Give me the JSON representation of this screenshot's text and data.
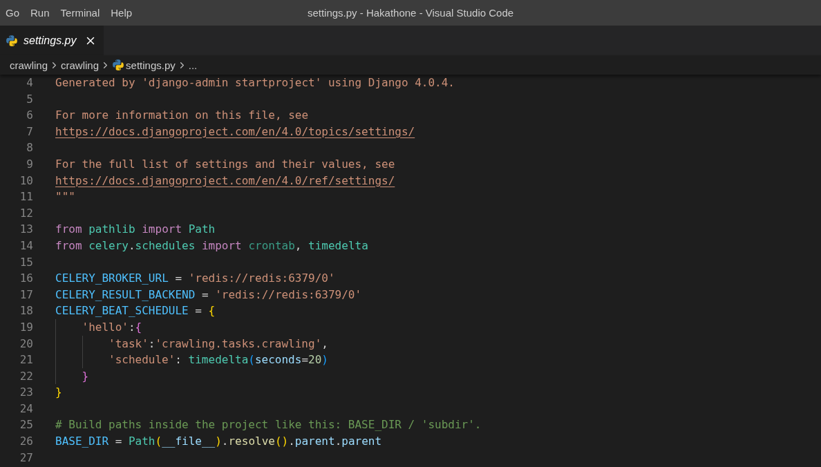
{
  "menu_bar": {
    "items": [
      "Go",
      "Run",
      "Terminal",
      "Help"
    ],
    "title": "settings.py - Hakathone - Visual Studio Code"
  },
  "tabs": [
    {
      "label": "settings.py",
      "selected": true,
      "preview": true
    }
  ],
  "breadcrumbs": [
    {
      "label": "crawling",
      "kind": "folder"
    },
    {
      "label": "crawling",
      "kind": "folder"
    },
    {
      "label": "settings.py",
      "kind": "file"
    },
    {
      "label": "...",
      "kind": "symbol"
    }
  ],
  "editor": {
    "lines": [
      {
        "number": "4",
        "tokens": [
          {
            "kind": "doc",
            "text": "Generated by 'django-admin startproject' using Django 4.0.4."
          }
        ]
      },
      {
        "number": "5"
      },
      {
        "number": "6",
        "tokens": [
          {
            "kind": "doc",
            "text": "For more information on this file, see"
          }
        ]
      },
      {
        "number": "7",
        "tokens": [
          {
            "kind": "link",
            "text": "https://docs.djangoproject.com/en/4.0/topics/settings/"
          }
        ]
      },
      {
        "number": "8"
      },
      {
        "number": "9",
        "tokens": [
          {
            "kind": "doc",
            "text": "For the full list of settings and their values, see"
          }
        ]
      },
      {
        "number": "10",
        "tokens": [
          {
            "kind": "link",
            "text": "https://docs.djangoproject.com/en/4.0/ref/settings/"
          }
        ]
      },
      {
        "number": "11",
        "tokens": [
          {
            "kind": "doc",
            "text": "\"\"\""
          }
        ]
      },
      {
        "number": "12"
      },
      {
        "number": "13",
        "tokens": [
          {
            "kind": "keyword",
            "text": "from"
          },
          {
            "kind": "module",
            "text": " pathlib"
          },
          {
            "kind": "keyword",
            "text": " import"
          },
          {
            "kind": "class",
            "text": " Path"
          }
        ]
      },
      {
        "number": "14",
        "tokens": [
          {
            "kind": "keyword",
            "text": "from"
          },
          {
            "kind": "module",
            "text": " celery"
          },
          {
            "kind": "plain",
            "text": "."
          },
          {
            "kind": "module",
            "text": "schedules"
          },
          {
            "kind": "keyword",
            "text": " import"
          },
          {
            "kind": "unresolved",
            "text": " crontab"
          },
          {
            "kind": "plain",
            "text": ", "
          },
          {
            "kind": "class",
            "text": "timedelta"
          }
        ]
      },
      {
        "number": "15"
      },
      {
        "number": "16",
        "tokens": [
          {
            "kind": "constant",
            "text": "CELERY_BROKER_URL"
          },
          {
            "kind": "plain",
            "text": " = "
          },
          {
            "kind": "string",
            "text": "'redis://redis:6379/0'"
          }
        ]
      },
      {
        "number": "17",
        "tokens": [
          {
            "kind": "constant",
            "text": "CELERY_RESULT_BACKEND"
          },
          {
            "kind": "plain",
            "text": " = "
          },
          {
            "kind": "string",
            "text": "'redis://redis:6379/0'"
          }
        ]
      },
      {
        "number": "18",
        "tokens": [
          {
            "kind": "constant",
            "text": "CELERY_BEAT_SCHEDULE"
          },
          {
            "kind": "plain",
            "text": " = "
          },
          {
            "kind": "bracket1",
            "text": "{"
          }
        ],
        "children": [
          {
            "number": "19",
            "tokens": [
              {
                "kind": "string",
                "text": "'hello'"
              },
              {
                "kind": "plain",
                "text": ":"
              },
              {
                "kind": "bracket2",
                "text": "{"
              }
            ],
            "children": [
              {
                "number": "20",
                "tokens": [
                  {
                    "kind": "string",
                    "text": "'task'"
                  },
                  {
                    "kind": "plain",
                    "text": ":"
                  },
                  {
                    "kind": "string",
                    "text": "'crawling.tasks.crawling'"
                  },
                  {
                    "kind": "plain",
                    "text": ","
                  }
                ]
              },
              {
                "number": "21",
                "tokens": [
                  {
                    "kind": "string",
                    "text": "'schedule'"
                  },
                  {
                    "kind": "plain",
                    "text": ": "
                  },
                  {
                    "kind": "class",
                    "text": "timedelta"
                  },
                  {
                    "kind": "bracket3",
                    "text": "("
                  },
                  {
                    "kind": "param",
                    "text": "seconds"
                  },
                  {
                    "kind": "plain",
                    "text": "="
                  },
                  {
                    "kind": "number",
                    "text": "20"
                  },
                  {
                    "kind": "bracket3",
                    "text": ")"
                  }
                ]
              }
            ]
          },
          {
            "number": "22",
            "tokens": [
              {
                "kind": "bracket2",
                "text": "}"
              }
            ]
          }
        ]
      },
      {
        "number": "23",
        "tokens": [
          {
            "kind": "bracket1",
            "text": "}"
          }
        ]
      },
      {
        "number": "24"
      },
      {
        "number": "25",
        "tokens": [
          {
            "kind": "comment",
            "text": "# Build paths inside the project like this: BASE_DIR / 'subdir'."
          }
        ]
      },
      {
        "number": "26",
        "tokens": [
          {
            "kind": "constant",
            "text": "BASE_DIR"
          },
          {
            "kind": "plain",
            "text": " = "
          },
          {
            "kind": "class",
            "text": "Path"
          },
          {
            "kind": "bracket1",
            "text": "("
          },
          {
            "kind": "variable",
            "text": "__file__"
          },
          {
            "kind": "bracket1",
            "text": ")"
          },
          {
            "kind": "plain",
            "text": "."
          },
          {
            "kind": "function",
            "text": "resolve"
          },
          {
            "kind": "bracket1",
            "text": "()"
          },
          {
            "kind": "plain",
            "text": "."
          },
          {
            "kind": "variable",
            "text": "parent"
          },
          {
            "kind": "plain",
            "text": "."
          },
          {
            "kind": "variable",
            "text": "parent"
          }
        ]
      },
      {
        "number": "27"
      }
    ]
  }
}
